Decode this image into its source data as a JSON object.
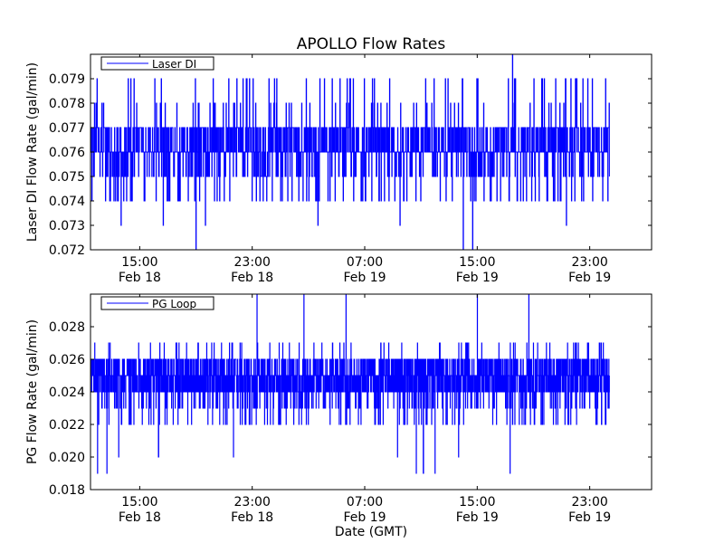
{
  "figure": {
    "title": "APOLLO Flow Rates",
    "xlabel": "Date (GMT)"
  },
  "chart_data": [
    {
      "type": "line",
      "title": "APOLLO Flow Rates",
      "xlabel": "",
      "ylabel": "Laser DI Flow Rate (gal/min)",
      "ylim": [
        0.072,
        0.08
      ],
      "yticks": [
        "0.072",
        "0.073",
        "0.074",
        "0.075",
        "0.076",
        "0.077",
        "0.078",
        "0.079"
      ],
      "xlim_hours": [
        -3.5,
        36.4
      ],
      "xticks": [
        {
          "hours": 0,
          "time": "15:00",
          "date": "Feb 18"
        },
        {
          "hours": 8,
          "time": "23:00",
          "date": "Feb 18"
        },
        {
          "hours": 16,
          "time": "07:00",
          "date": "Feb 19"
        },
        {
          "hours": 24,
          "time": "15:00",
          "date": "Feb 19"
        },
        {
          "hours": 32,
          "time": "23:00",
          "date": "Feb 19"
        }
      ],
      "legend": {
        "placement": "top-left"
      },
      "grid": false,
      "series": [
        {
          "name": "Laser DI",
          "color": "#0000ff",
          "baseline": 0.076,
          "resolution": 0.001,
          "typical_range": [
            0.074,
            0.079
          ],
          "x_start": "Feb 18 11:30",
          "x_end": "Feb 20 00:24",
          "dips": [
            {
              "x": "Feb 18 13:40",
              "y": 0.073
            },
            {
              "x": "Feb 18 16:40",
              "y": 0.073
            },
            {
              "x": "Feb 18 19:00",
              "y": 0.072
            },
            {
              "x": "Feb 18 19:40",
              "y": 0.073
            },
            {
              "x": "Feb 19 03:40",
              "y": 0.073
            },
            {
              "x": "Feb 19 09:30",
              "y": 0.073
            },
            {
              "x": "Feb 19 14:00",
              "y": 0.072
            },
            {
              "x": "Feb 19 14:40",
              "y": 0.072
            },
            {
              "x": "Feb 19 21:20",
              "y": 0.073
            }
          ],
          "peaks": [
            {
              "x": "Feb 19 17:30",
              "y": 0.08
            }
          ]
        }
      ]
    },
    {
      "type": "line",
      "title": "",
      "xlabel": "Date (GMT)",
      "ylabel": "PG Flow Rate (gal/min)",
      "ylim": [
        0.018,
        0.03
      ],
      "yticks": [
        "0.018",
        "0.020",
        "0.022",
        "0.024",
        "0.026",
        "0.028"
      ],
      "xlim_hours": [
        -3.5,
        36.4
      ],
      "xticks": [
        {
          "hours": 0,
          "time": "15:00",
          "date": "Feb 18"
        },
        {
          "hours": 8,
          "time": "23:00",
          "date": "Feb 18"
        },
        {
          "hours": 16,
          "time": "07:00",
          "date": "Feb 19"
        },
        {
          "hours": 24,
          "time": "15:00",
          "date": "Feb 19"
        },
        {
          "hours": 32,
          "time": "23:00",
          "date": "Feb 19"
        }
      ],
      "legend": {
        "placement": "top-left"
      },
      "grid": false,
      "series": [
        {
          "name": "PG Loop",
          "color": "#0000ff",
          "baseline": 0.025,
          "resolution": 0.001,
          "typical_range": [
            0.023,
            0.026
          ],
          "x_start": "Feb 18 11:30",
          "x_end": "Feb 20 00:24",
          "dips": [
            {
              "x": "Feb 18 12:00",
              "y": 0.019
            },
            {
              "x": "Feb 18 12:40",
              "y": 0.019
            },
            {
              "x": "Feb 18 13:30",
              "y": 0.02
            },
            {
              "x": "Feb 18 16:20",
              "y": 0.02
            },
            {
              "x": "Feb 18 21:40",
              "y": 0.02
            },
            {
              "x": "Feb 19 09:20",
              "y": 0.02
            },
            {
              "x": "Feb 19 10:40",
              "y": 0.019
            },
            {
              "x": "Feb 19 11:10",
              "y": 0.019
            },
            {
              "x": "Feb 19 12:00",
              "y": 0.019
            },
            {
              "x": "Feb 19 13:40",
              "y": 0.02
            },
            {
              "x": "Feb 19 17:20",
              "y": 0.019
            }
          ],
          "peaks": [
            {
              "x": "Feb 18 23:20",
              "y": 0.03
            },
            {
              "x": "Feb 19 02:40",
              "y": 0.03
            },
            {
              "x": "Feb 19 05:40",
              "y": 0.03
            },
            {
              "x": "Feb 19 15:00",
              "y": 0.03
            },
            {
              "x": "Feb 19 18:40",
              "y": 0.03
            }
          ]
        }
      ]
    }
  ]
}
